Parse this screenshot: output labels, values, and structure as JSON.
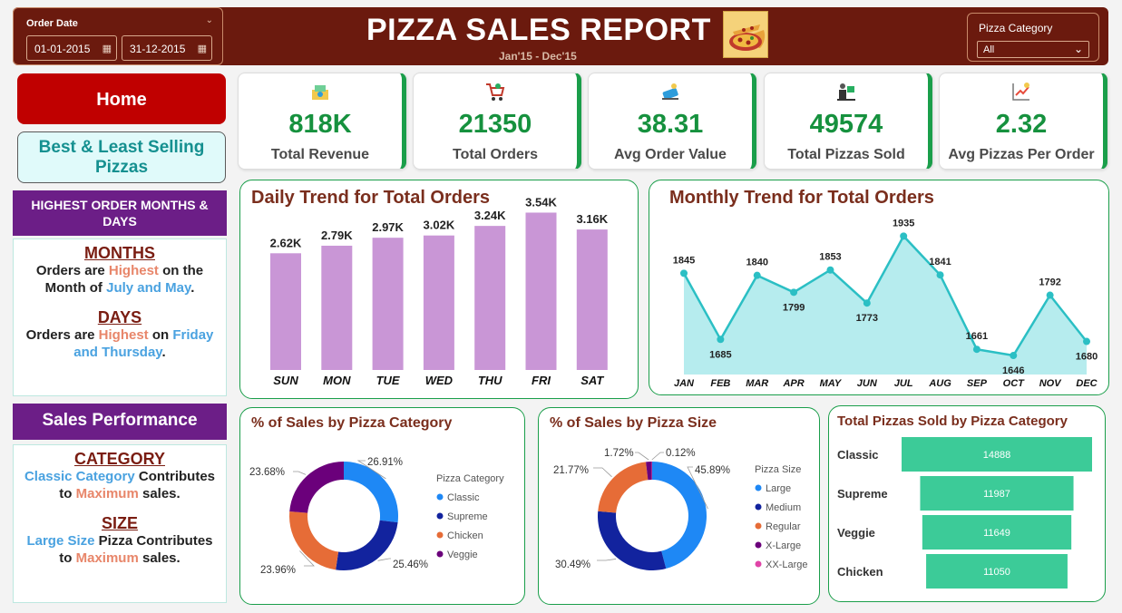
{
  "header": {
    "title": "PIZZA SALES REPORT",
    "subtitle": "Jan'15 - Dec'15",
    "order_date_label": "Order Date",
    "date_from": "01-01-2015",
    "date_to": "31-12-2015",
    "category_filter_label": "Pizza Category",
    "category_filter_value": "All"
  },
  "nav": {
    "home": "Home",
    "best_least": "Best & Least Selling Pizzas",
    "highest_heading": "HIGHEST ORDER MONTHS & DAYS",
    "sales_heading": "Sales Performance"
  },
  "insights": {
    "months_head": "MONTHS",
    "months_t1": "Orders are ",
    "months_t2": "Highest",
    "months_t3": " on the Month of ",
    "months_t4": "July and May",
    "months_t5": ".",
    "days_head": "DAYS",
    "days_t1": "Orders are ",
    "days_t2": "Highest",
    "days_t3": " on ",
    "days_t4": "Friday and Thursday",
    "days_t5": ".",
    "cat_head": "CATEGORY",
    "cat_t1": "Classic Category",
    "cat_t2": " Contributes to ",
    "cat_t3": "Maximum",
    "cat_t4": " sales.",
    "size_head": "SIZE",
    "size_t1": "Large Size",
    "size_t2": " Pizza Contributes to ",
    "size_t3": "Maximum",
    "size_t4": " sales."
  },
  "kpis": [
    {
      "value": "818K",
      "label": "Total Revenue"
    },
    {
      "value": "21350",
      "label": "Total Orders"
    },
    {
      "value": "38.31",
      "label": "Avg Order Value"
    },
    {
      "value": "49574",
      "label": "Total Pizzas Sold"
    },
    {
      "value": "2.32",
      "label": "Avg Pizzas Per Order"
    }
  ],
  "colors": {
    "header_bg": "#6b1a0e",
    "kpi_green": "#16913e",
    "bar": "#c996d6",
    "line": "#2bbfc4",
    "area": "#b6ecee",
    "hbar": "#3ccb98",
    "donut": [
      "#1e88f5",
      "#12239e",
      "#e66c37",
      "#6b007b",
      "#e044a7"
    ]
  },
  "chart_data": [
    {
      "type": "bar",
      "title": "Daily Trend for Total Orders",
      "categories": [
        "SUN",
        "MON",
        "TUE",
        "WED",
        "THU",
        "FRI",
        "SAT"
      ],
      "values": [
        2624,
        2794,
        2973,
        3024,
        3239,
        3538,
        3158
      ],
      "data_labels": [
        "2.62K",
        "2.79K",
        "2.97K",
        "3.02K",
        "3.24K",
        "3.54K",
        "3.16K"
      ],
      "ylim": [
        0,
        4000
      ]
    },
    {
      "type": "area",
      "title": "Monthly Trend for Total Orders",
      "categories": [
        "JAN",
        "FEB",
        "MAR",
        "APR",
        "MAY",
        "JUN",
        "JUL",
        "AUG",
        "SEP",
        "OCT",
        "NOV",
        "DEC"
      ],
      "values": [
        1845,
        1685,
        1840,
        1799,
        1853,
        1773,
        1935,
        1841,
        1661,
        1646,
        1792,
        1680
      ],
      "ylim": [
        1600,
        1960
      ]
    },
    {
      "type": "pie",
      "title": "% of Sales by Pizza Category",
      "legend_title": "Pizza Category",
      "labels": [
        "Classic",
        "Supreme",
        "Chicken",
        "Veggie"
      ],
      "values": [
        26.91,
        25.46,
        23.96,
        23.68
      ],
      "data_labels": [
        "26.91%",
        "25.46%",
        "23.96%",
        "23.68%"
      ]
    },
    {
      "type": "pie",
      "title": "% of Sales by Pizza Size",
      "legend_title": "Pizza Size",
      "labels": [
        "Large",
        "Medium",
        "Regular",
        "X-Large",
        "XX-Large"
      ],
      "values": [
        45.89,
        30.49,
        21.77,
        1.72,
        0.12
      ],
      "data_labels": [
        "45.89%",
        "30.49%",
        "21.77%",
        "1.72%",
        "0.12%"
      ]
    },
    {
      "type": "bar",
      "orientation": "horizontal",
      "title": "Total Pizzas Sold by Pizza Category",
      "categories": [
        "Classic",
        "Supreme",
        "Veggie",
        "Chicken"
      ],
      "values": [
        14888,
        11987,
        11649,
        11050
      ],
      "data_labels": [
        "14888",
        "11987",
        "11649",
        "11050"
      ]
    }
  ]
}
